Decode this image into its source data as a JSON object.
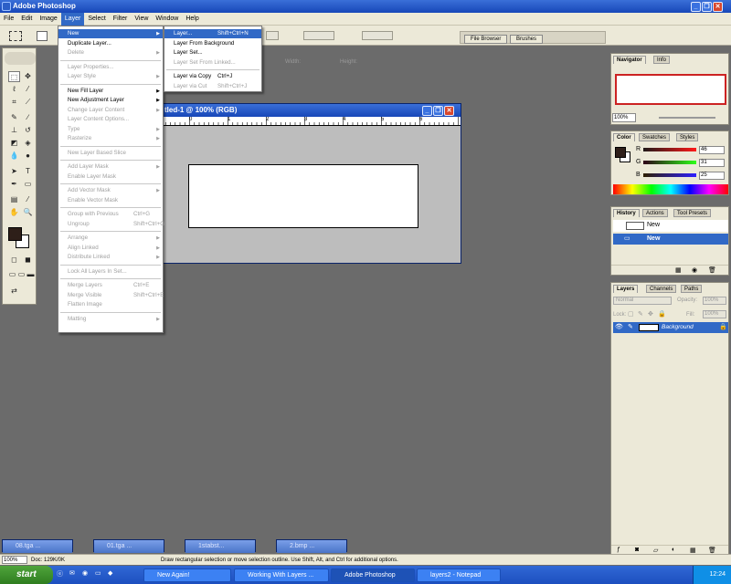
{
  "app": {
    "title": "Adobe Photoshop"
  },
  "menubar": {
    "items": [
      "File",
      "Edit",
      "Image",
      "Layer",
      "Select",
      "Filter",
      "View",
      "Window",
      "Help"
    ],
    "active": "Layer"
  },
  "options": {
    "width_label": "Width:",
    "height_label": "Height:"
  },
  "palette_well": {
    "tabs": [
      "File Browser",
      "Brushes"
    ]
  },
  "document": {
    "title": "tled-1 @ 100% (RGB)",
    "ruler_ticks": [
      "0",
      "1",
      "2",
      "3",
      "4",
      "5",
      "6"
    ]
  },
  "layer_menu": {
    "items": [
      {
        "label": "New",
        "submenu": true,
        "disabled": false,
        "highlighted": true
      },
      {
        "label": "Duplicate Layer...",
        "disabled": false
      },
      {
        "label": "Delete",
        "submenu": true,
        "disabled": true
      },
      {
        "sep": true
      },
      {
        "label": "Layer Properties...",
        "disabled": true
      },
      {
        "label": "Layer Style",
        "submenu": true,
        "disabled": true
      },
      {
        "sep": true
      },
      {
        "label": "New Fill Layer",
        "submenu": true,
        "disabled": false
      },
      {
        "label": "New Adjustment Layer",
        "submenu": true,
        "disabled": false
      },
      {
        "label": "Change Layer Content",
        "submenu": true,
        "disabled": true
      },
      {
        "label": "Layer Content Options...",
        "disabled": true
      },
      {
        "label": "Type",
        "submenu": true,
        "disabled": true
      },
      {
        "label": "Rasterize",
        "submenu": true,
        "disabled": true
      },
      {
        "sep": true
      },
      {
        "label": "New Layer Based Slice",
        "disabled": true
      },
      {
        "sep": true
      },
      {
        "label": "Add Layer Mask",
        "submenu": true,
        "disabled": true
      },
      {
        "label": "Enable Layer Mask",
        "disabled": true
      },
      {
        "sep": true
      },
      {
        "label": "Add Vector Mask",
        "submenu": true,
        "disabled": true
      },
      {
        "label": "Enable Vector Mask",
        "disabled": true
      },
      {
        "sep": true
      },
      {
        "label": "Group with Previous",
        "shortcut": "Ctrl+G",
        "disabled": true
      },
      {
        "label": "Ungroup",
        "shortcut": "Shift+Ctrl+G",
        "disabled": true
      },
      {
        "sep": true
      },
      {
        "label": "Arrange",
        "submenu": true,
        "disabled": true
      },
      {
        "label": "Align Linked",
        "submenu": true,
        "disabled": true
      },
      {
        "label": "Distribute Linked",
        "submenu": true,
        "disabled": true
      },
      {
        "sep": true
      },
      {
        "label": "Lock All Layers In Set...",
        "disabled": true
      },
      {
        "sep": true
      },
      {
        "label": "Merge Layers",
        "shortcut": "Ctrl+E",
        "disabled": true
      },
      {
        "label": "Merge Visible",
        "shortcut": "Shift+Ctrl+E",
        "disabled": true
      },
      {
        "label": "Flatten Image",
        "disabled": true
      },
      {
        "sep": true
      },
      {
        "label": "Matting",
        "submenu": true,
        "disabled": true
      }
    ]
  },
  "new_submenu": {
    "items": [
      {
        "label": "Layer...",
        "shortcut": "Shift+Ctrl+N",
        "disabled": false,
        "highlighted": true
      },
      {
        "label": "Layer From Background",
        "disabled": false
      },
      {
        "label": "Layer Set...",
        "disabled": false
      },
      {
        "label": "Layer Set From Linked...",
        "disabled": true
      },
      {
        "sep": true
      },
      {
        "label": "Layer via Copy",
        "shortcut": "Ctrl+J",
        "disabled": false
      },
      {
        "label": "Layer via Cut",
        "shortcut": "Shift+Ctrl+J",
        "disabled": true
      }
    ]
  },
  "navigator": {
    "tabs": [
      "Navigator",
      "Info"
    ],
    "zoom": "100%"
  },
  "color": {
    "tabs": [
      "Color",
      "Swatches",
      "Styles"
    ],
    "r_label": "R",
    "g_label": "G",
    "b_label": "B",
    "r": "46",
    "g": "31",
    "b": "25",
    "foreground": "#2e1f19"
  },
  "history": {
    "tabs": [
      "History",
      "Actions",
      "Tool Presets"
    ],
    "snapshot": "New",
    "state": "New"
  },
  "layers": {
    "tabs": [
      "Layers",
      "Channels",
      "Paths"
    ],
    "blend": "Normal",
    "opacity_label": "Opacity:",
    "opacity": "100%",
    "lock_label": "Lock:",
    "fill_label": "Fill:",
    "fill": "100%",
    "layer_name": "Background"
  },
  "minimized": [
    {
      "title": "08.tga ..."
    },
    {
      "title": "01.tga ..."
    },
    {
      "title": "1stabst..."
    },
    {
      "title": "2.bmp ..."
    }
  ],
  "status": {
    "zoom": "100%",
    "doc": "Doc: 129K/0K",
    "hint": "Draw rectangular selection or move selection outline.  Use Shift, Alt, and Ctrl for additional options."
  },
  "taskbar": {
    "start": "start",
    "tasks": [
      "New Again!",
      "Working With Layers ...",
      "Adobe Photoshop",
      "layers2 - Notepad"
    ],
    "active_task": "Adobe Photoshop",
    "clock": "12:24"
  }
}
